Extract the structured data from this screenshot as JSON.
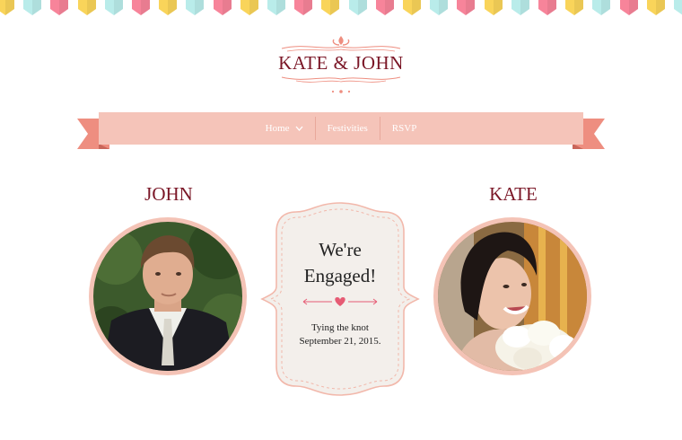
{
  "site": {
    "logo_text": "KATE & JOHN"
  },
  "nav": {
    "items": [
      {
        "label": "Home",
        "has_dropdown": true,
        "icon": "chevron-down-icon"
      },
      {
        "label": "Festivities"
      },
      {
        "label": "RSVP"
      }
    ]
  },
  "couple": {
    "groom_name": "JOHN",
    "bride_name": "KATE"
  },
  "announcement": {
    "title_line1": "We're",
    "title_line2": "Engaged!",
    "subtitle_line1": "Tying the knot",
    "subtitle_line2": "September 21, 2015."
  },
  "colors": {
    "accent": "#7a1626",
    "ribbon": "#f5c4b9",
    "ribbon_dark": "#ee8e80",
    "heart": "#e65b74",
    "bunting": [
      "#f9d45a",
      "#b9ecea",
      "#f7849a"
    ]
  }
}
